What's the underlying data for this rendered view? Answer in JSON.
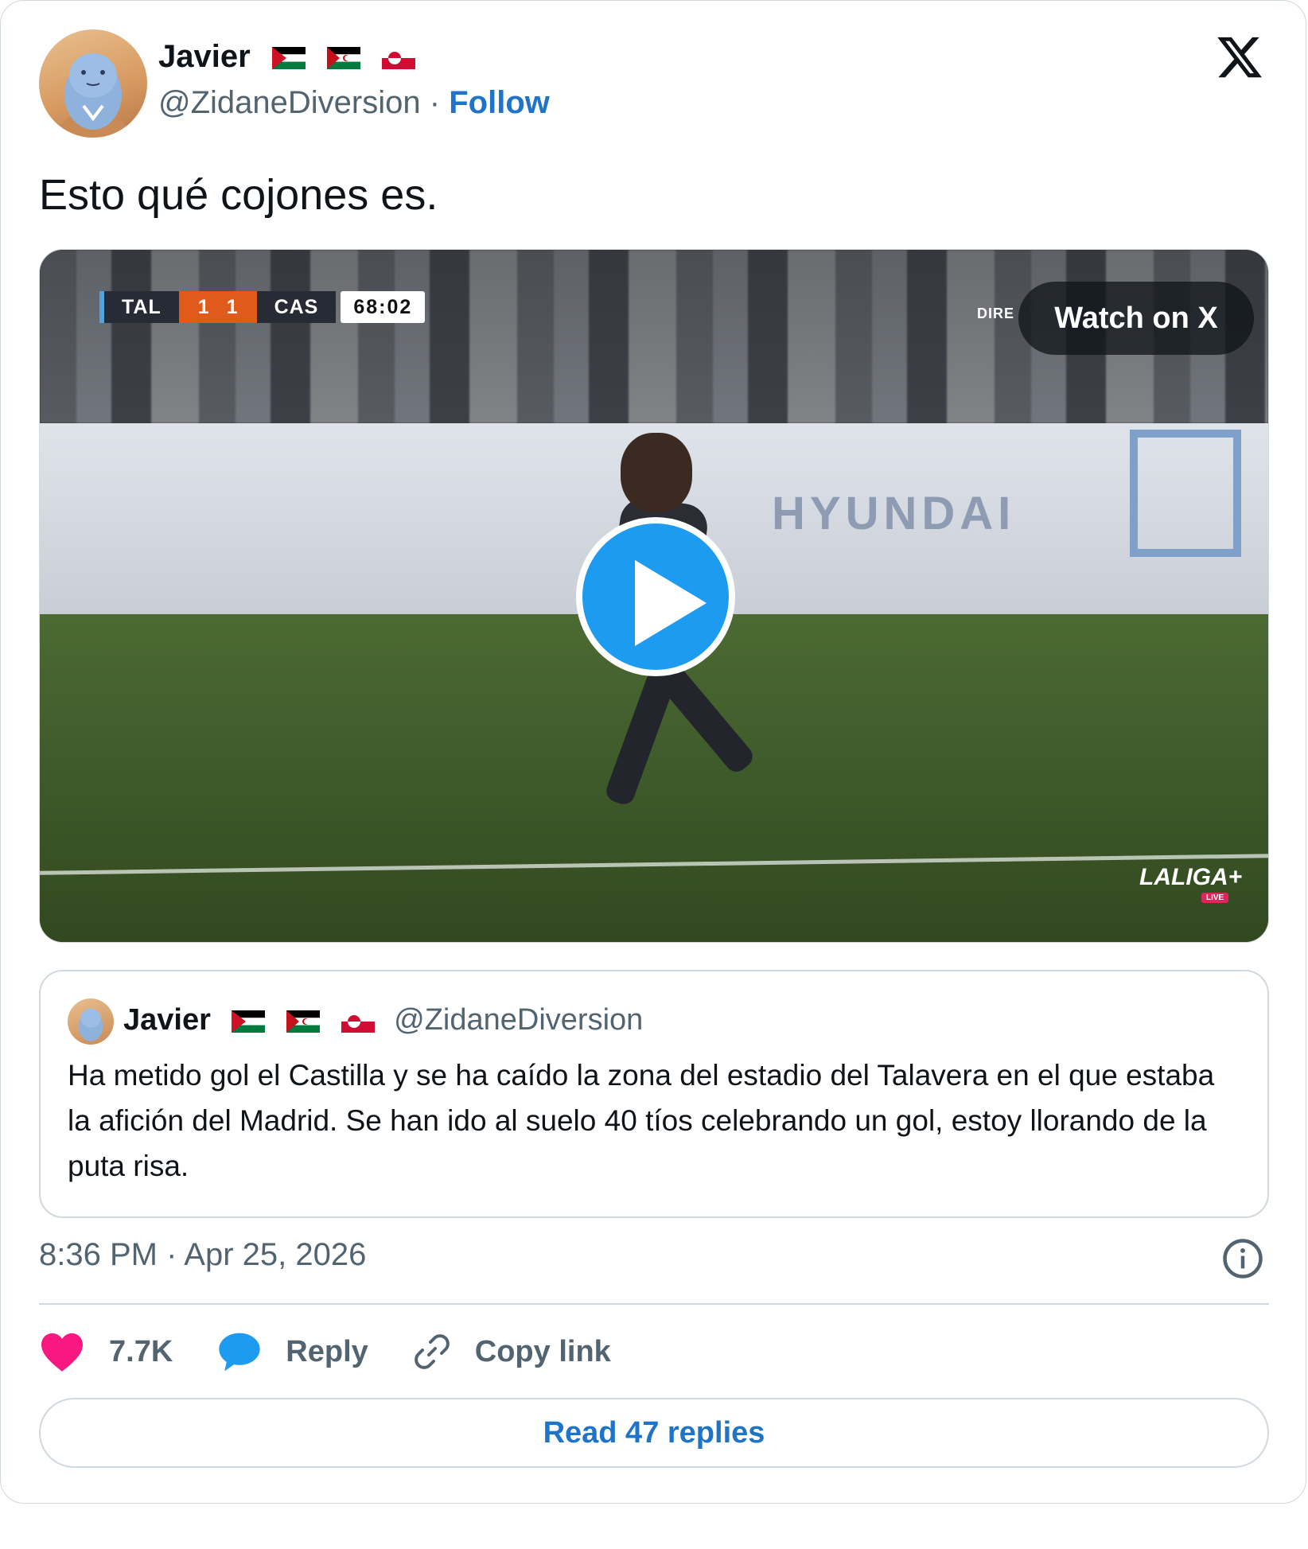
{
  "tweet": {
    "author_name": "Javier",
    "author_flags": [
      "flag-palestine-icon",
      "flag-western-sahara-icon",
      "flag-greenland-icon"
    ],
    "handle": "@ZidaneDiversion",
    "separator": "·",
    "follow_label": "Follow",
    "text": "Esto qué cojones es.",
    "timestamp": "8:36 PM · Apr 25, 2026"
  },
  "media": {
    "type": "video",
    "watch_label": "Watch on X",
    "scoreboard": {
      "home": "TAL",
      "home_score": "1",
      "away_score": "1",
      "away": "CAS",
      "clock": "68:02"
    },
    "overlay_text": "DIRE",
    "ad_board_text": "HYUNDAI",
    "broadcaster": "LALIGA+",
    "broadcaster_tag": "LIVE"
  },
  "quoted_tweet": {
    "author_name": "Javier",
    "handle": "@ZidaneDiversion",
    "text": "Ha metido gol el Castilla y se ha caído la zona del estadio del Talavera en el que estaba la afición del Madrid. Se han ido al suelo 40 tíos celebrando un gol, estoy llorando de la puta risa."
  },
  "actions": {
    "like_count": "7.7K",
    "reply_label": "Reply",
    "copy_link_label": "Copy link",
    "read_replies_label": "Read 47 replies"
  },
  "colors": {
    "link_blue": "#1d74c8",
    "play_blue": "#1d9bf0",
    "like_pink": "#f91880",
    "reply_blue": "#1d9bf0",
    "muted_text": "#536471",
    "border": "#cfd9de"
  }
}
